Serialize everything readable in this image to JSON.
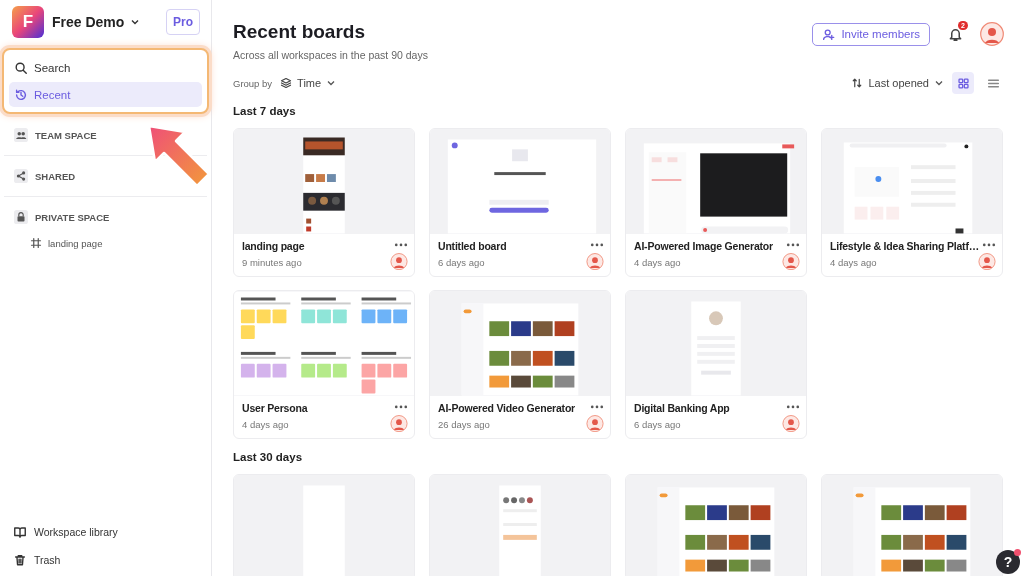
{
  "workspace": {
    "logo_letter": "F",
    "name": "Free Demo",
    "plan": "Pro"
  },
  "nav": [
    {
      "label": "Search",
      "selected": false
    },
    {
      "label": "Recent",
      "selected": true
    }
  ],
  "spaces": [
    {
      "label": "TEAM SPACE"
    },
    {
      "label": "SHARED"
    },
    {
      "label": "PRIVATE SPACE",
      "children": [
        {
          "label": "landing page"
        }
      ]
    }
  ],
  "sidebar_footer": [
    {
      "label": "Workspace library"
    },
    {
      "label": "Trash"
    }
  ],
  "header": {
    "title": "Recent boards",
    "subtitle": "Across all workspaces in the past 90 days",
    "invite_button": "Invite members",
    "notification_count": "2"
  },
  "toolbar": {
    "group_label": "Group by",
    "group_value": "Time",
    "sort_value": "Last opened",
    "views": [
      {
        "kind": "grid",
        "selected": true
      },
      {
        "kind": "list",
        "selected": false
      }
    ]
  },
  "sections": [
    {
      "title": "Last 7 days",
      "boards": [
        {
          "title": "landing page",
          "time": "9 minutes ago",
          "kind": "mobile"
        },
        {
          "title": "Untitled board",
          "time": "6 days ago",
          "kind": "form"
        },
        {
          "title": "AI-Powered Image Generator",
          "time": "4 days ago",
          "kind": "editor"
        },
        {
          "title": "Lifestyle & Idea Sharing Platf…",
          "time": "4 days ago",
          "kind": "dialog"
        },
        {
          "title": "User Persona",
          "time": "4 days ago",
          "kind": "sticky"
        },
        {
          "title": "AI-Powered Video Generator",
          "time": "26 days ago",
          "kind": "dashboard"
        },
        {
          "title": "Digital Banking App",
          "time": "6 days ago",
          "kind": "phone"
        }
      ]
    },
    {
      "title": "Last 30 days",
      "boards": [
        {
          "kind": "blank"
        },
        {
          "kind": "feed"
        },
        {
          "kind": "dashboard"
        },
        {
          "kind": "dashboard"
        }
      ]
    }
  ],
  "help_button": "?"
}
